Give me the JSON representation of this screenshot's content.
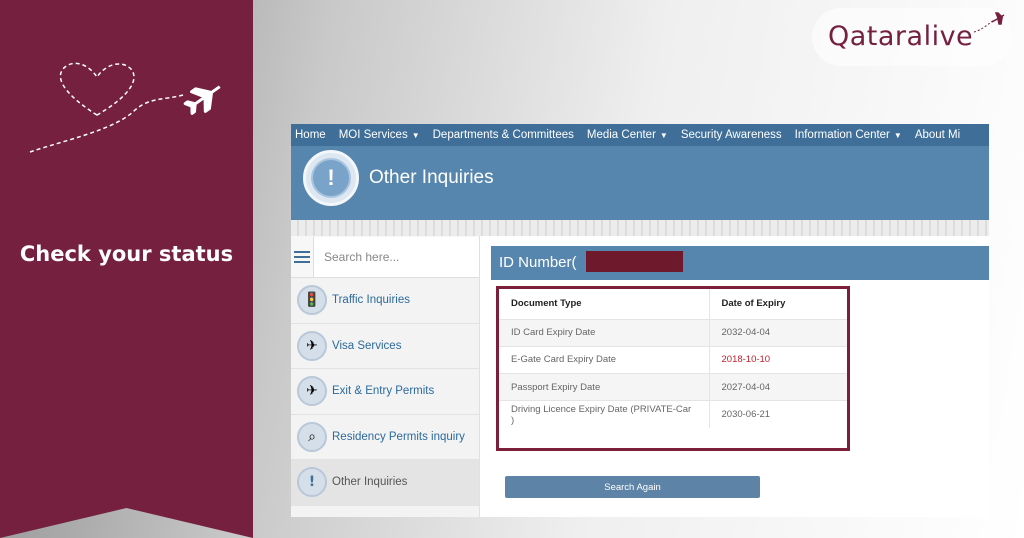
{
  "ribbon": {
    "title": "Check your status",
    "decoration": [
      "heart-icon",
      "airplane-icon"
    ]
  },
  "logo": {
    "text": "Qataralive",
    "icon": "airplane-icon"
  },
  "navbar": {
    "items": [
      {
        "label": "Home",
        "caret": false
      },
      {
        "label": "MOI Services",
        "caret": true
      },
      {
        "label": "Departments & Committees",
        "caret": false
      },
      {
        "label": "Media Center",
        "caret": true
      },
      {
        "label": "Security Awareness",
        "caret": false
      },
      {
        "label": "Information Center",
        "caret": true
      },
      {
        "label": "About Mi",
        "caret": false
      }
    ]
  },
  "header": {
    "title": "Other Inquiries",
    "icon": "exclamation-icon"
  },
  "sidebar": {
    "search_placeholder": "Search here...",
    "items": [
      {
        "label": "Traffic Inquiries",
        "icon": "traffic-light-icon"
      },
      {
        "label": "Visa Services",
        "icon": "visa-icon"
      },
      {
        "label": "Exit & Entry Permits",
        "icon": "airplane-icon"
      },
      {
        "label": "Residency Permits inquiry",
        "icon": "residency-icon"
      },
      {
        "label": "Other Inquiries",
        "icon": "exclamation-icon"
      }
    ]
  },
  "main": {
    "id_label": "ID Number(",
    "table": {
      "headers": [
        "Document Type",
        "Date of Expiry"
      ],
      "rows": [
        {
          "type": "ID Card Expiry Date",
          "date": "2032-04-04"
        },
        {
          "type": "E-Gate Card Expiry Date",
          "date": "2018-10-10"
        },
        {
          "type": "Passport Expiry Date",
          "date": "2027-04-04"
        },
        {
          "type": "Driving Licence Expiry Date (PRIVATE-Car )",
          "date": "2030-06-21"
        }
      ]
    },
    "search_again_label": "Search Again"
  },
  "colors": {
    "maroon": "#75203f",
    "nav_blue": "#3f6f99",
    "header_blue": "#5686ad",
    "expired_red": "#c0202c"
  }
}
